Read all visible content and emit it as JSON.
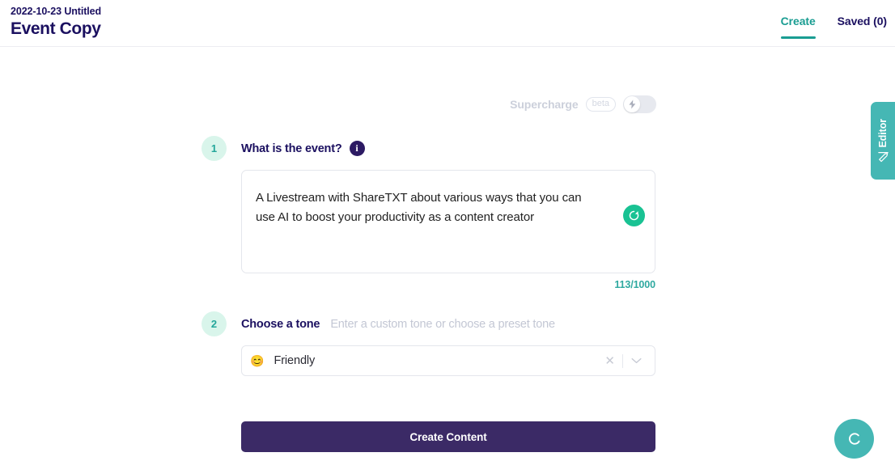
{
  "header": {
    "doc_date": "2022-10-23 Untitled",
    "doc_title": "Event Copy",
    "tabs": [
      {
        "label": "Create",
        "active": true
      },
      {
        "label": "Saved (0)",
        "active": false
      }
    ]
  },
  "supercharge": {
    "label": "Supercharge",
    "badge": "beta",
    "toggle_state": "off",
    "icon": "lightning-bolt-icon"
  },
  "steps": [
    {
      "number": "1",
      "label": "What is the event?",
      "info_icon": "info-icon",
      "info_glyph": "i"
    },
    {
      "number": "2",
      "label": "Choose a tone",
      "hint": "Enter a custom tone or choose a preset tone"
    }
  ],
  "event_input": {
    "value": "A Livestream with ShareTXT about various ways that you can use AI to boost your productivity as a content creator",
    "placeholder": "What is the event?",
    "char_count": "113/1000",
    "regenerate_icon": "refresh-icon"
  },
  "tone_select": {
    "emoji": "😊",
    "value": "Friendly",
    "clear_glyph": "✕",
    "caret_icon": "chevron-down-icon"
  },
  "submit": {
    "label": "Create Content"
  },
  "editor_tab": {
    "label": "Editor",
    "icon": "pencil-icon"
  },
  "chat_widget": {
    "label": "C",
    "icon": "chat-icon"
  },
  "colors": {
    "brand_navy": "#1b1060",
    "teal": "#1a9d92",
    "mint": "#d9f5eb",
    "green": "#19c293",
    "purple": "#3b2a66",
    "tab_teal": "#45b7b4",
    "muted": "#c3c7d4"
  }
}
